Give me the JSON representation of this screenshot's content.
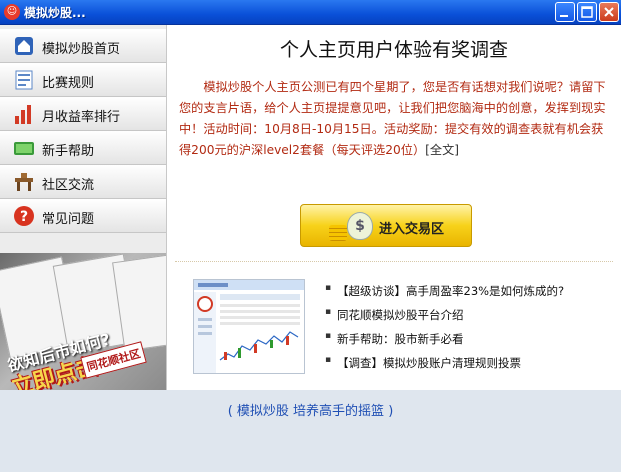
{
  "window": {
    "title": "模拟炒股...",
    "icon": "app-logo-icon"
  },
  "sidebar": {
    "items": [
      {
        "label": "模拟炒股首页",
        "icon": "home-icon"
      },
      {
        "label": "比赛规则",
        "icon": "rules-icon"
      },
      {
        "label": "月收益率排行",
        "icon": "bar-chart-icon"
      },
      {
        "label": "新手帮助",
        "icon": "help-book-icon"
      },
      {
        "label": "社区交流",
        "icon": "community-icon"
      },
      {
        "label": "常见问题",
        "icon": "question-icon"
      }
    ],
    "banner": {
      "question": "欲知后市如何?",
      "cta": "立即点击",
      "tag": "同花顺社区"
    }
  },
  "main": {
    "heading": "个人主页用户体验有奖调查",
    "description": "模拟炒股个人主页公测已有四个星期了，您是否有话想对我们说呢？请留下您的支言片语，给个人主页提提意见吧，让我们把您脑海中的创意，发挥到现实中！活动时间：10月8日-10月15日。活动奖励：提交有效的调查表就有机会获得200元的沪深level2套餐（每天评选20位）",
    "full_text_link": "[全文]",
    "enter_button": "进入交易区",
    "news": [
      "【超级访谈】高手周盈率23%是如何炼成的?",
      "同花顺模拟炒股平台介绍",
      "新手帮助：股市新手必看",
      "【调查】模拟炒股账户清理规则投票"
    ]
  },
  "footer": {
    "slogan": "( 模拟炒股 培养高手的摇篮 )"
  },
  "colors": {
    "title_bar": "#0a50d8",
    "accent_red": "#b22a12",
    "slogan_blue": "#1f4fb4",
    "button_gold": "#f7d21a"
  }
}
